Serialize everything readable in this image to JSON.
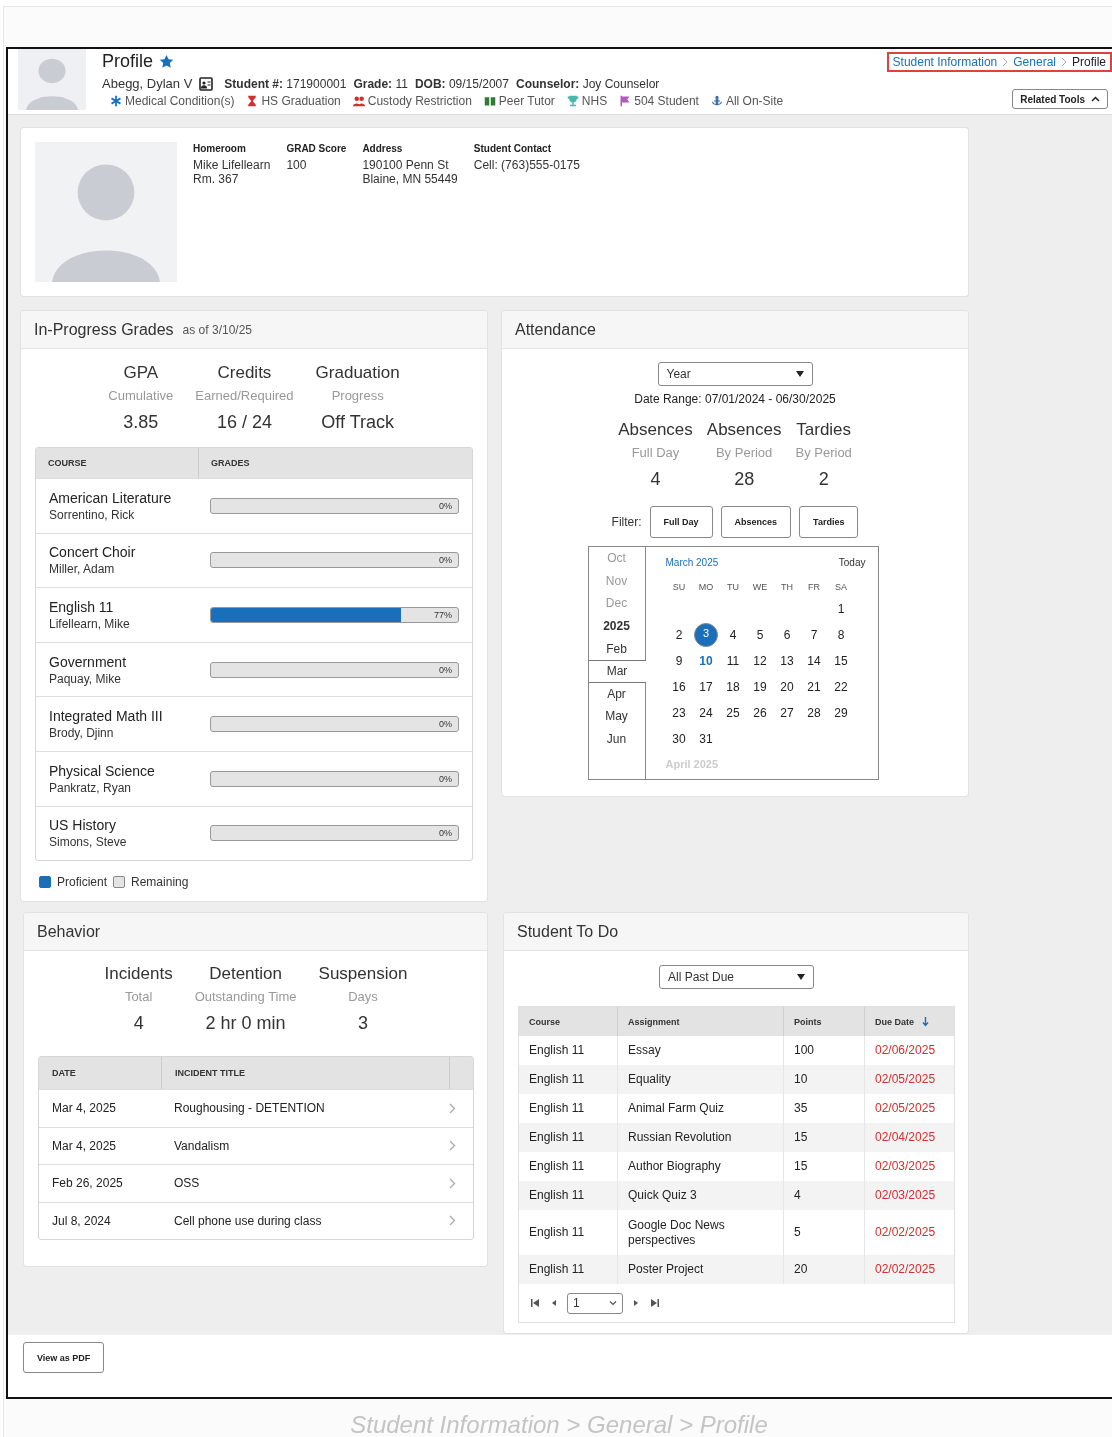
{
  "header": {
    "title": "Profile",
    "favorite": true,
    "student_name": "Abegg, Dylan V",
    "details": [
      {
        "label": "Student #:",
        "value": "171900001"
      },
      {
        "label": "Grade:",
        "value": "11"
      },
      {
        "label": "DOB:",
        "value": "09/15/2007"
      },
      {
        "label": "Counselor:",
        "value": "Joy Counselor"
      }
    ],
    "flags": [
      {
        "kind": "medical",
        "label": "Medical Condition(s)",
        "color": "#1a73c8"
      },
      {
        "kind": "graduation",
        "label": "HS Graduation",
        "color": "#d32f2f"
      },
      {
        "kind": "custody",
        "label": "Custody Restriction",
        "color": "#d32f2f"
      },
      {
        "kind": "tutor",
        "label": "Peer Tutor",
        "color": "#2e7d32"
      },
      {
        "kind": "nhs",
        "label": "NHS",
        "color": "#4db6ac"
      },
      {
        "kind": "plan",
        "label": "504 Student",
        "color": "#b05cc0"
      },
      {
        "kind": "onsite",
        "label": "All On-Site",
        "color": "#3a6ea5"
      }
    ],
    "breadcrumb": [
      {
        "label": "Student Information",
        "current": false
      },
      {
        "label": "General",
        "current": false
      },
      {
        "label": "Profile",
        "current": true
      }
    ],
    "related_tools": "Related Tools"
  },
  "summary": {
    "fields": [
      {
        "label": "Homeroom",
        "lines": [
          "Mike Lifellearn",
          "Rm. 367"
        ]
      },
      {
        "label": "GRAD Score",
        "lines": [
          "100"
        ]
      },
      {
        "label": "Address",
        "lines": [
          "190100 Penn St",
          "Blaine, MN 55449"
        ]
      },
      {
        "label": "Student Contact",
        "lines": [
          "Cell: (763)555-0175"
        ]
      }
    ]
  },
  "grades": {
    "title": "In-Progress Grades",
    "as_of": "as of 3/10/25",
    "stats": [
      {
        "title": "GPA",
        "subtitle": "Cumulative",
        "value": "3.85"
      },
      {
        "title": "Credits",
        "subtitle": "Earned/Required",
        "value": "16 / 24"
      },
      {
        "title": "Graduation",
        "subtitle": "Progress",
        "value": "Off Track"
      }
    ],
    "columns": [
      "COURSE",
      "GRADES"
    ],
    "courses": [
      {
        "name": "American Literature",
        "teacher": "Sorrentino, Rick",
        "level": 0,
        "percent": "0%"
      },
      {
        "name": "Concert Choir",
        "teacher": "Miller, Adam",
        "level": 0,
        "percent": "0%"
      },
      {
        "name": "English 11",
        "teacher": "Lifellearn, Mike",
        "level": 0.77,
        "percent": "77%"
      },
      {
        "name": "Government",
        "teacher": "Paquay, Mike",
        "level": 0,
        "percent": "0%"
      },
      {
        "name": "Integrated Math III",
        "teacher": "Brody, Djinn",
        "level": 0,
        "percent": "0%"
      },
      {
        "name": "Physical Science",
        "teacher": "Pankratz, Ryan",
        "level": 0,
        "percent": "0%"
      },
      {
        "name": "US History",
        "teacher": "Simons, Steve",
        "level": 0,
        "percent": "0%"
      }
    ],
    "legend": [
      {
        "label": "Proficient",
        "color": "#1a6fba"
      },
      {
        "label": "Remaining",
        "color": "#e4e4e4"
      }
    ]
  },
  "attendance": {
    "title": "Attendance",
    "range_select": "Year",
    "date_range": "Date Range: 07/01/2024 - 06/30/2025",
    "stats": [
      {
        "title": "Absences",
        "subtitle": "Full Day",
        "value": "4"
      },
      {
        "title": "Absences",
        "subtitle": "By Period",
        "value": "28"
      },
      {
        "title": "Tardies",
        "subtitle": "By Period",
        "value": "2"
      }
    ],
    "filter_label": "Filter:",
    "filters": [
      "Full Day",
      "Absences",
      "Tardies"
    ],
    "calendar": {
      "months": [
        {
          "label": "Oct",
          "kind": "month",
          "dimmed": true,
          "selected": false
        },
        {
          "label": "Nov",
          "kind": "month",
          "dimmed": true,
          "selected": false
        },
        {
          "label": "Dec",
          "kind": "month",
          "dimmed": true,
          "selected": false
        },
        {
          "label": "2025",
          "kind": "year",
          "dimmed": false,
          "selected": false
        },
        {
          "label": "Feb",
          "kind": "month",
          "dimmed": false,
          "selected": false
        },
        {
          "label": "Mar",
          "kind": "month",
          "dimmed": false,
          "selected": true
        },
        {
          "label": "Apr",
          "kind": "month",
          "dimmed": false,
          "selected": false
        },
        {
          "label": "May",
          "kind": "month",
          "dimmed": false,
          "selected": false
        },
        {
          "label": "Jun",
          "kind": "month",
          "dimmed": false,
          "selected": false
        }
      ],
      "month_title": "March 2025",
      "today_label": "Today",
      "weekdays": [
        "SU",
        "MO",
        "TU",
        "WE",
        "TH",
        "FR",
        "SA"
      ],
      "weeks": [
        [
          {
            "day": "1",
            "selected": false,
            "today": false
          }
        ],
        [
          {
            "day": "2",
            "selected": false,
            "today": false
          },
          {
            "day": "3",
            "selected": true,
            "today": false
          },
          {
            "day": "4",
            "selected": false,
            "today": false
          },
          {
            "day": "5",
            "selected": false,
            "today": false
          },
          {
            "day": "6",
            "selected": false,
            "today": false
          },
          {
            "day": "7",
            "selected": false,
            "today": false
          },
          {
            "day": "8",
            "selected": false,
            "today": false
          }
        ],
        [
          {
            "day": "9",
            "selected": false,
            "today": false
          },
          {
            "day": "10",
            "selected": false,
            "today": true
          },
          {
            "day": "11",
            "selected": false,
            "today": false
          },
          {
            "day": "12",
            "selected": false,
            "today": false
          },
          {
            "day": "13",
            "selected": false,
            "today": false
          },
          {
            "day": "14",
            "selected": false,
            "today": false
          },
          {
            "day": "15",
            "selected": false,
            "today": false
          }
        ],
        [
          {
            "day": "16",
            "selected": false,
            "today": false
          },
          {
            "day": "17",
            "selected": false,
            "today": false
          },
          {
            "day": "18",
            "selected": false,
            "today": false
          },
          {
            "day": "19",
            "selected": false,
            "today": false
          },
          {
            "day": "20",
            "selected": false,
            "today": false
          },
          {
            "day": "21",
            "selected": false,
            "today": false
          },
          {
            "day": "22",
            "selected": false,
            "today": false
          }
        ],
        [
          {
            "day": "23",
            "selected": false,
            "today": false
          },
          {
            "day": "24",
            "selected": false,
            "today": false
          },
          {
            "day": "25",
            "selected": false,
            "today": false
          },
          {
            "day": "26",
            "selected": false,
            "today": false
          },
          {
            "day": "27",
            "selected": false,
            "today": false
          },
          {
            "day": "28",
            "selected": false,
            "today": false
          },
          {
            "day": "29",
            "selected": false,
            "today": false
          }
        ],
        [
          {
            "day": "30",
            "selected": false,
            "today": false
          },
          {
            "day": "31",
            "selected": false,
            "today": false
          }
        ]
      ],
      "next_month": "April 2025"
    }
  },
  "behavior": {
    "title": "Behavior",
    "stats": [
      {
        "title": "Incidents",
        "subtitle": "Total",
        "value": "4"
      },
      {
        "title": "Detention",
        "subtitle": "Outstanding Time",
        "value": "2 hr 0 min"
      },
      {
        "title": "Suspension",
        "subtitle": "Days",
        "value": "3"
      }
    ],
    "columns": [
      "DATE",
      "INCIDENT TITLE"
    ],
    "incidents": [
      {
        "date": "Mar 4, 2025",
        "title": "Roughousing - DETENTION"
      },
      {
        "date": "Mar 4, 2025",
        "title": "Vandalism"
      },
      {
        "date": "Feb 26, 2025",
        "title": "OSS"
      },
      {
        "date": "Jul 8, 2024",
        "title": "Cell phone use during class"
      }
    ]
  },
  "todo": {
    "title": "Student To Do",
    "filter_select": "All Past Due",
    "columns": [
      {
        "label": "Course",
        "sorted": false
      },
      {
        "label": "Assignment",
        "sorted": false
      },
      {
        "label": "Points",
        "sorted": false
      },
      {
        "label": "Due Date",
        "sorted": true
      }
    ],
    "rows": [
      {
        "course": "English 11",
        "assignment": "Essay",
        "points": "100",
        "due_date": "02/06/2025",
        "overdue": true
      },
      {
        "course": "English 11",
        "assignment": "Equality",
        "points": "10",
        "due_date": "02/05/2025",
        "overdue": true
      },
      {
        "course": "English 11",
        "assignment": "Animal Farm Quiz",
        "points": "35",
        "due_date": "02/05/2025",
        "overdue": true
      },
      {
        "course": "English 11",
        "assignment": "Russian Revolution",
        "points": "15",
        "due_date": "02/04/2025",
        "overdue": true
      },
      {
        "course": "English 11",
        "assignment": "Author Biography",
        "points": "15",
        "due_date": "02/03/2025",
        "overdue": true
      },
      {
        "course": "English 11",
        "assignment": "Quick Quiz 3",
        "points": "4",
        "due_date": "02/03/2025",
        "overdue": true
      },
      {
        "course": "English 11",
        "assignment": "Google Doc News perspectives",
        "points": "5",
        "due_date": "02/02/2025",
        "overdue": true
      },
      {
        "course": "English 11",
        "assignment": "Poster Project",
        "points": "20",
        "due_date": "02/02/2025",
        "overdue": true
      }
    ],
    "page": "1"
  },
  "footer": {
    "pdf_button": "View as PDF"
  },
  "caption": "Student Information > General > Profile"
}
